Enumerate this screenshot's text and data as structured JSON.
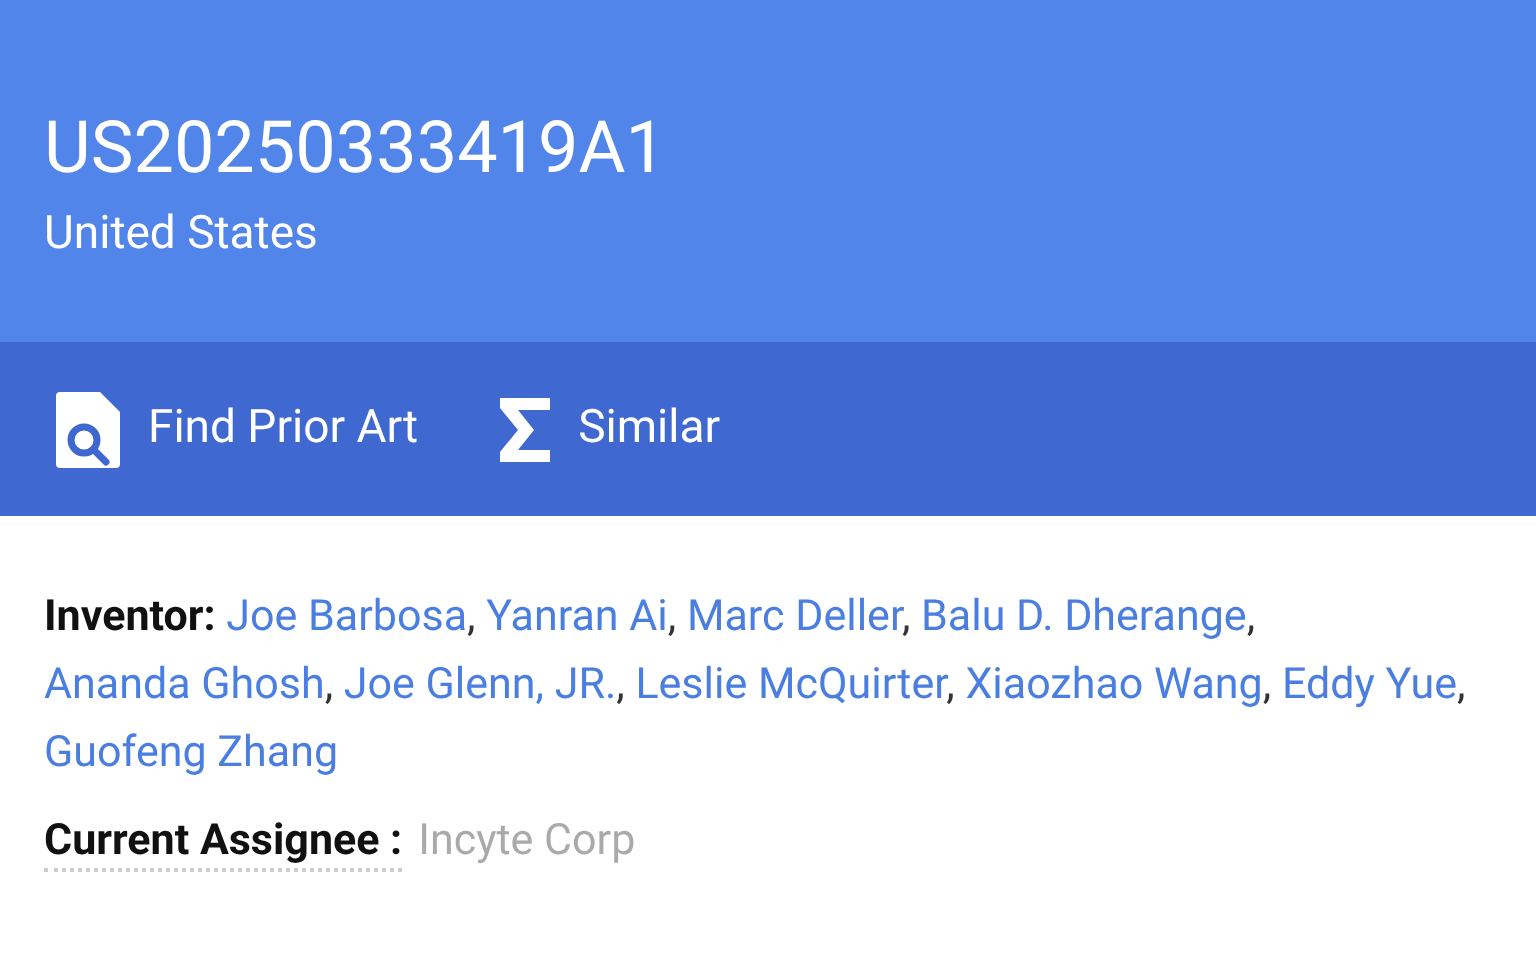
{
  "header": {
    "title": "US20250333419A1",
    "subtitle": "United States"
  },
  "actions": [
    {
      "kind": "prior-art",
      "label": "Find Prior Art"
    },
    {
      "kind": "similar",
      "label": "Similar"
    }
  ],
  "inventors": {
    "label": "Inventor:",
    "separator": ",",
    "names": [
      "Joe Barbosa",
      "Yanran Ai",
      "Marc Deller",
      "Balu D. Dherange",
      "Ananda Ghosh",
      "Joe Glenn, JR.",
      "Leslie McQuirter",
      "Xiaozhao Wang",
      "Eddy Yue",
      "Guofeng Zhang"
    ]
  },
  "assignee": {
    "label": "Current Assignee :",
    "value": "Incyte Corp"
  }
}
